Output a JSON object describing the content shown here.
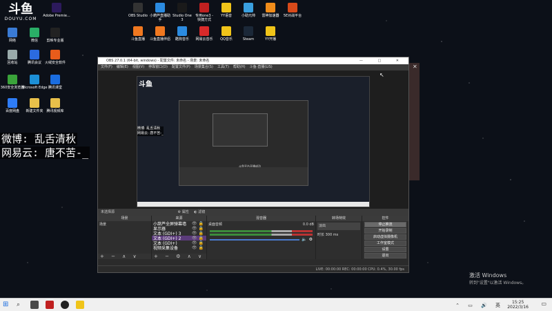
{
  "desktop": {
    "logo": {
      "mark": "斗鱼",
      "text": "DOUYU.COM"
    },
    "icons_left": [
      {
        "label": "Adobe Premie...",
        "color": "#2c1a5c"
      },
      {
        "label": "网络",
        "color": "#3a7bd5"
      },
      {
        "label": "微信",
        "color": "#2aae67"
      },
      {
        "label": "剪映专业版",
        "color": "#222"
      },
      {
        "label": "回收站",
        "color": "#9aa"
      },
      {
        "label": "腾讯会议",
        "color": "#2b6be0"
      },
      {
        "label": "火绒安全软件",
        "color": "#e85c1b"
      },
      {
        "label": "360安全浏览器",
        "color": "#3aa33a"
      },
      {
        "label": "Microsoft Edge",
        "color": "#1c8fd6"
      },
      {
        "label": "腾讯课堂",
        "color": "#1a6de0"
      },
      {
        "label": "百度网盘",
        "color": "#2e7cf6"
      },
      {
        "label": "新建文件夹",
        "color": "#e8c04a"
      },
      {
        "label": "腾讯视频库",
        "color": "#e8c04a"
      }
    ],
    "icons_top": [
      {
        "label": "OBS Studio",
        "color": "#333"
      },
      {
        "label": "小葫芦直播助手",
        "color": "#2b8be0"
      },
      {
        "label": "Studio One 3",
        "color": "#1a1a1a"
      },
      {
        "label": "专用one3 - 快捷方式",
        "color": "#c02020"
      },
      {
        "label": "YY语音",
        "color": "#f0c419"
      },
      {
        "label": "小助元帅",
        "color": "#3aa0e0"
      },
      {
        "label": "雷神加速器",
        "color": "#f08c1a"
      },
      {
        "label": "5E对战平台",
        "color": "#d84a1a"
      },
      {
        "label": "斗鱼直播",
        "color": "#f07820"
      },
      {
        "label": "斗鱼直播伴侣",
        "color": "#f07820"
      },
      {
        "label": "酷狗音乐",
        "color": "#2b8be0"
      },
      {
        "label": "网易云音乐",
        "color": "#d82a2a"
      },
      {
        "label": "QQ音乐",
        "color": "#f0c419"
      },
      {
        "label": "Steam",
        "color": "#1b2838"
      },
      {
        "label": "YY开播",
        "color": "#f0c419"
      }
    ],
    "overlay_line1": "微博: 乱舌清秋",
    "overlay_line2": "网易云: 唐不苦-_",
    "activate_title": "激活 Windows",
    "activate_sub": "转到\"设置\"以激活 Windows。"
  },
  "obs": {
    "title": "OBS 27.0.1 (64-bit, windows) - 配置文件: 未命名 - 场景: 未命名",
    "window_controls": "— □ ✕",
    "menu": [
      "文件(F)",
      "编辑(E)",
      "视图(V)",
      "停靠窗口(D)",
      "配置文件(P)",
      "场景集合(S)",
      "工具(T)",
      "帮助(H)",
      "斗鱼-直播(LIS)"
    ],
    "nested_overlay_1": "微博: 乱舌清秋",
    "nested_overlay_2": "网易云: 唐不苦-_",
    "nested_caption": "斗鱼平台开播成功",
    "toolbar": {
      "label": "未选择源",
      "props": "属性",
      "filters": "滤镜"
    },
    "docks": {
      "scenes": {
        "header": "场景",
        "items": [
          "场景"
        ]
      },
      "sources": {
        "header": "来源",
        "items": [
          {
            "label": "小葫芦全屏弹幕墙",
            "selected": false
          },
          {
            "label": "显示器",
            "selected": false
          },
          {
            "label": "文本 (GDI+) 3",
            "selected": false
          },
          {
            "label": "文本 (GDI+) 2",
            "selected": true
          },
          {
            "label": "文本 (GDI+)",
            "selected": false
          },
          {
            "label": "视频采集设备",
            "selected": false
          }
        ]
      },
      "mixer": {
        "header": "混音器",
        "track": "桌面音频",
        "db": "0.0 dB"
      },
      "transitions": {
        "header": "转场特效",
        "value": "淡出",
        "duration_label": "时长",
        "duration": "300 ms"
      },
      "controls": {
        "header": "控件",
        "buttons": [
          "停止推流",
          "开始录制",
          "启动虚拟摄像机",
          "工作室模式",
          "设置",
          "退出"
        ]
      }
    },
    "status": "LIVE: 00:00:00   REC: 00:00:00   CPU: 0.4%, 30.00 fps"
  },
  "taskbar": {
    "time": "15:25",
    "date": "2022/3/16"
  }
}
